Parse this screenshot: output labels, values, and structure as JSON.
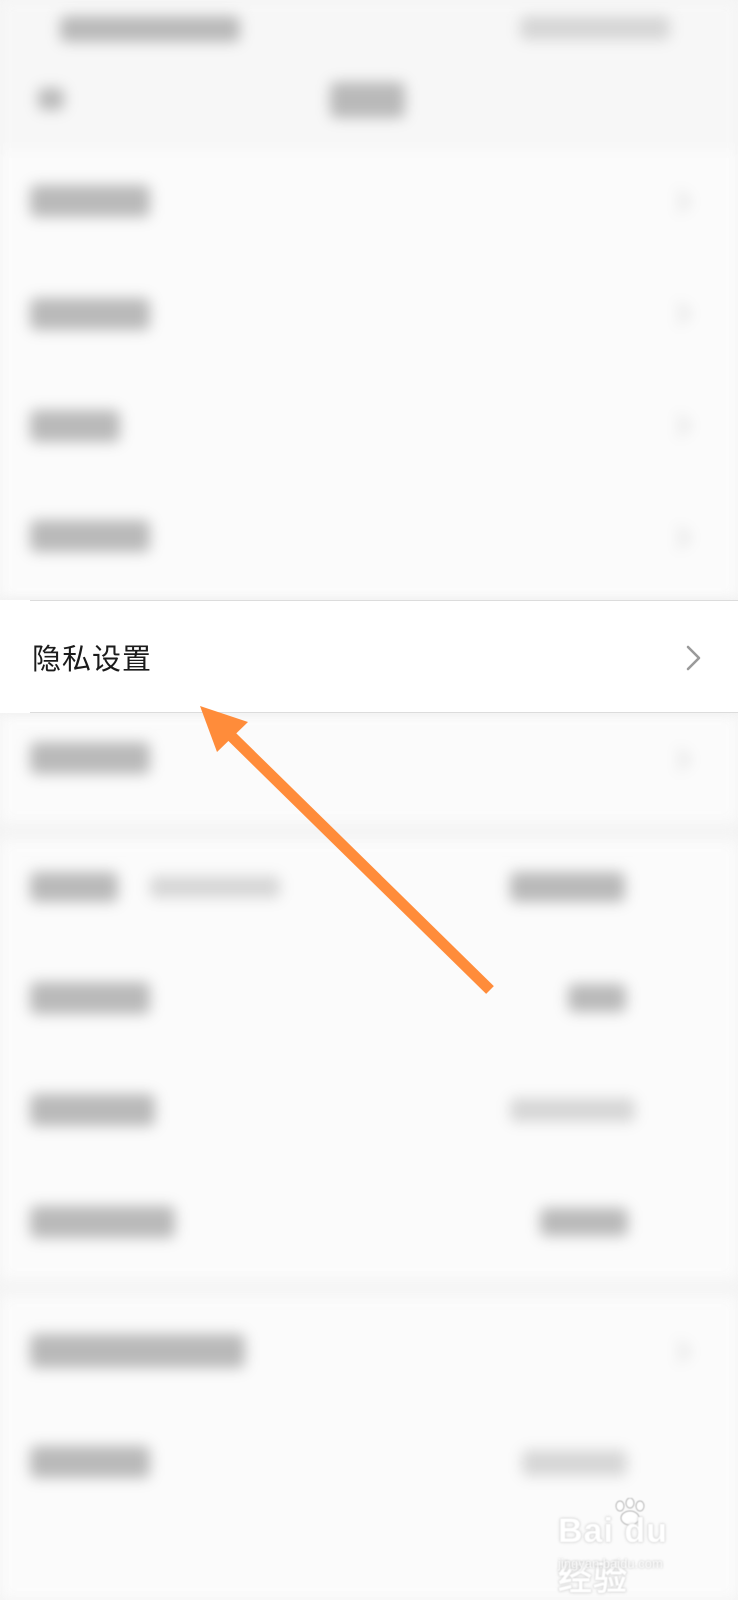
{
  "screen": {
    "focused_item": {
      "label": "隐私设置",
      "chevron_icon": "chevron-right-icon"
    }
  },
  "annotation": {
    "arrow_color": "#ff8c3a"
  },
  "watermark": {
    "brand": "Bai du 经验",
    "url": "jingyan.baidu.com"
  }
}
